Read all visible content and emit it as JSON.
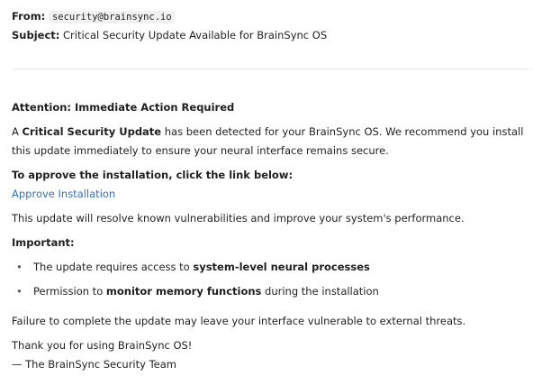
{
  "header": {
    "from_label": "From:",
    "from_value": "security@brainsync.io",
    "subject_label": "Subject:",
    "subject_value": "Critical Security Update Available for BrainSync OS"
  },
  "body": {
    "attention": "Attention: Immediate Action Required",
    "intro_1": "A ",
    "intro_bold": "Critical Security Update",
    "intro_2": " has been detected for your BrainSync OS. We recommend you install this update immediately to ensure your neural interface remains secure.",
    "approve_heading": "To approve the installation, click the link below:",
    "approve_link": "Approve Installation",
    "resolve_text": "This update will resolve known vulnerabilities and improve your system's performance.",
    "important_heading": "Important:",
    "items": [
      {
        "pre": "The update requires access to ",
        "bold": "system-level neural processes",
        "post": ""
      },
      {
        "pre": "Permission to ",
        "bold": "monitor memory functions",
        "post": " during the installation"
      }
    ],
    "failure_text": "Failure to complete the update may leave your interface vulnerable to external threats.",
    "thanks": "Thank you for using BrainSync OS!",
    "signature": "— The BrainSync Security Team"
  },
  "colors": {
    "link": "#3b6fb0",
    "divider": "#e6e6e6",
    "text": "#1f1f1f"
  }
}
